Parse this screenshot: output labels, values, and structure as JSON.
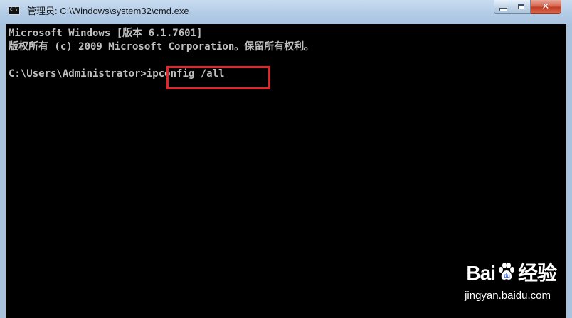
{
  "window": {
    "title": "管理员: C:\\Windows\\system32\\cmd.exe",
    "icon_label": "C:\\"
  },
  "controls": {
    "minimize_icon": "minimize-icon",
    "maximize_icon": "maximize-icon",
    "close_icon": "close-icon",
    "close_glyph": "✕"
  },
  "console": {
    "line1": "Microsoft Windows [版本 6.1.7601]",
    "line2": "版权所有 (c) 2009 Microsoft Corporation。保留所有权利。",
    "prompt": "C:\\Users\\Administrator>",
    "command": "ipconfig /all"
  },
  "watermark": {
    "logo": "Bai  经验",
    "logo_left": "Bai",
    "logo_right": "经验",
    "url": "jingyan.baidu.com"
  },
  "colors": {
    "console_bg": "#000000",
    "console_text": "#c0c0c0",
    "highlight": "#e0262a",
    "title_bar": "#b3cce6"
  }
}
